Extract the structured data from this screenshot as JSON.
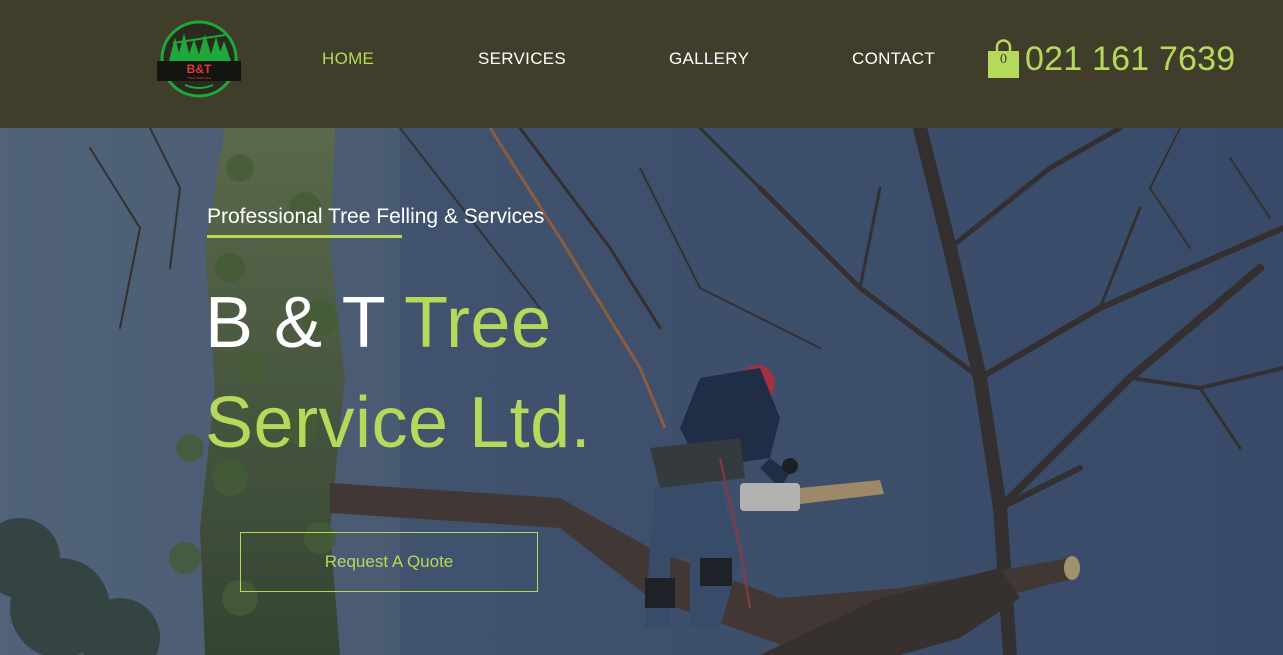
{
  "header": {
    "logo": {
      "text": "B&T",
      "subtext": "TREE SERVICES"
    },
    "nav": [
      {
        "label": "HOME",
        "active": true
      },
      {
        "label": "SERVICES",
        "active": false
      },
      {
        "label": "GALLERY",
        "active": false
      },
      {
        "label": "CONTACT",
        "active": false
      }
    ],
    "cart": {
      "count": "0",
      "icon": "shopping-bag-icon"
    },
    "phone": "021 161 7639"
  },
  "hero": {
    "tagline": "Professional Tree Felling & Services",
    "title": {
      "line1_white": "B & T ",
      "line1_accent": "Tree",
      "line2_accent": "Service Ltd."
    },
    "cta_label": "Request A Quote",
    "image": "arborist-cutting-tree-with-chainsaw"
  },
  "colors": {
    "header_bg": "#403e2a",
    "accent": "#b5d95a",
    "hero_overlay": "#46576f"
  }
}
